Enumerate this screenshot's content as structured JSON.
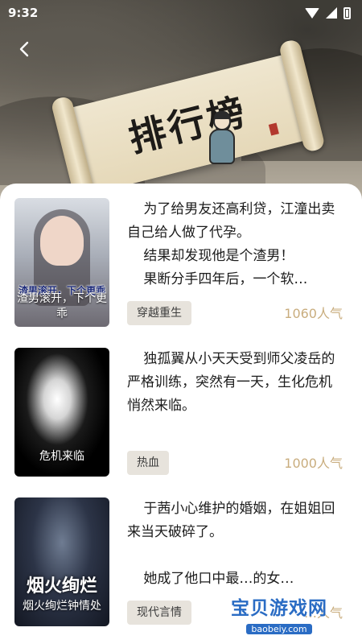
{
  "status_bar": {
    "time": "9:32"
  },
  "header": {
    "title": "排行榜"
  },
  "books": [
    {
      "cover_art_title": "渣男滚开，下个更乖",
      "cover_caption": "渣男滚开，下个更乖",
      "description_lines": [
        "为了给男友还高利贷，江潼出卖自己给人做了代孕。",
        "结果却发现他是个渣男！",
        "果断分手四年后，一个软…"
      ],
      "tag": "穿越重生",
      "popularity": "1060人气"
    },
    {
      "cover_art_title": "",
      "cover_caption": "危机来临",
      "description_lines": [
        "独孤翼从小天天受到师父凌岳的严格训练，突然有一天，生化危机悄然来临。"
      ],
      "tag": "热血",
      "popularity": "1000人气"
    },
    {
      "cover_art_title": "烟火绚烂",
      "cover_caption": "烟火绚烂钟情处",
      "description_lines": [
        "于茜小心维护的婚姻，在姐姐回来当天破碎了。",
        "",
        "她成了他口中最…的女…"
      ],
      "tag": "现代言情",
      "popularity": "…人气"
    }
  ],
  "watermark": {
    "main": "宝贝游戏网",
    "sub": "baobeiy.com"
  },
  "colors": {
    "tag_bg": "#e7e3dc",
    "popularity_text": "#c9ad7e",
    "watermark_blue": "#2a6cc4"
  }
}
